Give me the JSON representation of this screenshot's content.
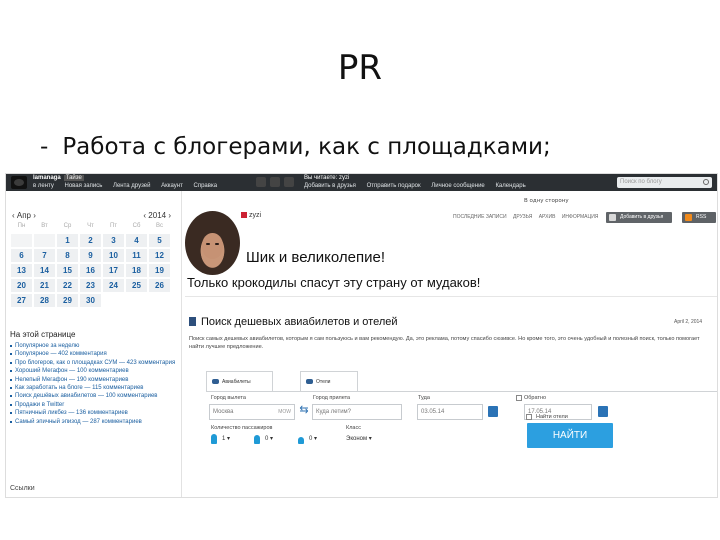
{
  "slide": {
    "title": "PR",
    "bullet": "Работа с блогерами, как с площадками;"
  },
  "topbar": {
    "user": "lamanaga",
    "badge": "Тайзе",
    "left_links": [
      "в ленту",
      "Новая запись",
      "Лента друзей",
      "Аккаунт",
      "Справка"
    ],
    "mid_title": "Вы читаете: zyzi",
    "mid_links": [
      "Добавить в друзья",
      "Отправить подарок",
      "Личное сообщение",
      "Календарь"
    ],
    "search_placeholder": "Поиск по блогу"
  },
  "calendar": {
    "month": "‹ Апр ›",
    "year": "‹ 2014 ›",
    "dows": [
      "Пн",
      "Вт",
      "Ср",
      "Чт",
      "Пт",
      "Сб",
      "Вс"
    ],
    "days": [
      "",
      "",
      "1",
      "2",
      "3",
      "4",
      "5",
      "6",
      "7",
      "8",
      "9",
      "10",
      "11",
      "12",
      "13",
      "14",
      "15",
      "16",
      "17",
      "18",
      "19",
      "20",
      "21",
      "22",
      "23",
      "24",
      "25",
      "26",
      "27",
      "28",
      "29",
      "30"
    ]
  },
  "sidebar": {
    "title": "На этой странице",
    "items": [
      "Популярное за неделю",
      "Популярное — 402 комментария",
      "Про блогеров, как о площадках СУМ — 423 комментария",
      "Хороший Мегафон — 100 комментариев",
      "Нелепый Мегафон — 190 комментариев",
      "Как заработать на блоге — 115 комментариев",
      "Поиск дешёвых авиабилетов — 100 комментариев",
      "Продажи в Twitter",
      "Пятничный ликбез — 136 комментариев",
      "Самый эпичный эпизод — 287 комментариев"
    ],
    "more": "Ссылки"
  },
  "post": {
    "author": "zyzi",
    "nav": [
      "Последние записи",
      "Друзья",
      "Архив",
      "Информация"
    ],
    "friend_button": "Добавить в друзья",
    "rss_button": "RSS",
    "blog_title": "Шик и великолепие!",
    "blog_subtitle": "Только крокодилы спасут эту страну от мудаков!"
  },
  "ad": {
    "title": "Поиск дешевых авиабилетов и отелей",
    "date": "April 2, 2014",
    "text": "Поиск самых дешевых авиабилетов, которым я сам пользуюсь и вам рекомендую. Да, это реклама, потому спасибо сюзивсе. Но кроме того, это очень удобный и полезный поиск, только помогает найти лучшее предложение."
  },
  "widget": {
    "tab1": "Авиабилеты",
    "tab2": "Отели",
    "from_label": "Город вылета",
    "from_value": "Москва",
    "from_code": "MOW",
    "to_label": "Город прилета",
    "to_placeholder": "Куда летим?",
    "there_label": "Туда",
    "there_value": "03.05.14",
    "back_label": "Обратно",
    "back_value": "17.05.14",
    "pax_label": "Количество пассажиров",
    "adults": "1",
    "children": "0",
    "infants": "0",
    "class_label": "Класс",
    "class_value": "Эконом",
    "one_way_label": "В одну сторону",
    "hotels_label": "Найти отели",
    "find_button": "НАЙТИ"
  }
}
